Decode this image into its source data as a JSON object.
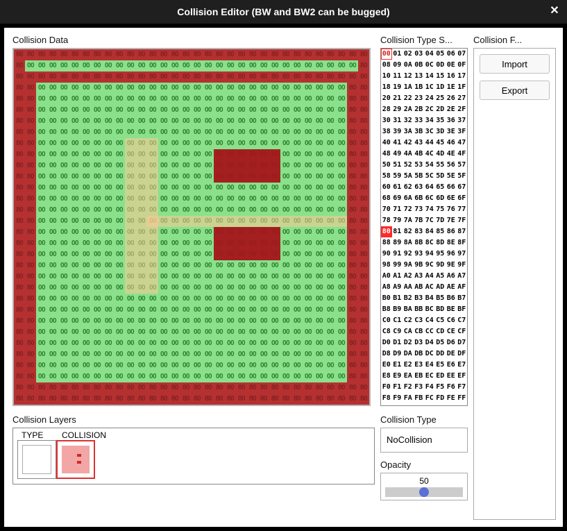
{
  "title": "Collision Editor (BW and BW2 can be bugged)",
  "labels": {
    "collision_data": "Collision Data",
    "type_selector": "Collision Type S...",
    "collision_file": "Collision F...",
    "import": "Import",
    "export": "Export",
    "collision_layers": "Collision Layers",
    "layer_type": "TYPE",
    "layer_collision": "COLLISION",
    "collision_type": "Collision Type",
    "collision_type_value": "NoCollision",
    "opacity": "Opacity",
    "opacity_value": "50"
  },
  "grid": {
    "size": 32,
    "cells": "built-in-script"
  },
  "type_rows": [
    "00 01 02 03 04 05 06 07",
    "08 09 0A 0B 0C 0D 0E 0F",
    "10 11 12 13 14 15 16 17",
    "18 19 1A 1B 1C 1D 1E 1F",
    "20 21 22 23 24 25 26 27",
    "28 29 2A 2B 2C 2D 2E 2F",
    "30 31 32 33 34 35 36 37",
    "38 39 3A 3B 3C 3D 3E 3F",
    "40 41 42 43 44 45 46 47",
    "48 49 4A 4B 4C 4D 4E 4F",
    "50 51 52 53 54 55 56 57",
    "58 59 5A 5B 5C 5D 5E 5F",
    "60 61 62 63 64 65 66 67",
    "68 69 6A 6B 6C 6D 6E 6F",
    "70 71 72 73 74 75 76 77",
    "78 79 7A 7B 7C 7D 7E 7F",
    "80 81 82 83 84 85 86 87",
    "88 89 8A 8B 8C 8D 8E 8F",
    "90 91 92 93 94 95 96 97",
    "98 99 9A 9B 9C 9D 9E 9F",
    "A0 A1 A2 A3 A4 A5 A6 A7",
    "A8 A9 AA AB AC AD AE AF",
    "B0 B1 B2 B3 B4 B5 B6 B7",
    "B8 B9 BA BB BC BD BE BF",
    "C0 C1 C2 C3 C4 C5 C6 C7",
    "C8 C9 CA CB CC CD CE CF",
    "D0 D1 D2 D3 D4 D5 D6 D7",
    "D8 D9 DA DB DC DD DE DF",
    "E0 E1 E2 E3 E4 E5 E6 E7",
    "E8 E9 EA EB EC ED EE EF",
    "F0 F1 F2 F3 F4 F5 F6 F7",
    "F8 F9 FA FB FC FD FE FF"
  ],
  "selected_type_hex": "80",
  "outlined_type_hex": "00",
  "collision_map_80_regions": {
    "description": "Cells with value 80 (collision). Coordinates zero-indexed, size 32x32.",
    "border_outer": {
      "rows": [
        0,
        31
      ],
      "cols_full": true
    },
    "border_sides": {
      "cols": [
        0,
        31
      ],
      "rows_full": true
    },
    "inner_ring": {
      "top_row": 2,
      "bottom_row": 30,
      "left_col": 1,
      "right_col": 30,
      "thickness": 1
    },
    "blocks": [
      {
        "row_start": 9,
        "row_end": 11,
        "col_start": 18,
        "col_end": 23
      },
      {
        "row_start": 16,
        "row_end": 18,
        "col_start": 18,
        "col_end": 23
      }
    ]
  },
  "overlay_regions": [
    {
      "name": "column-highlight",
      "row_start": 8,
      "row_end": 21,
      "col_start": 10,
      "col_end": 12,
      "tint": "orange"
    },
    {
      "name": "row-highlight",
      "row_start": 15,
      "row_end": 16,
      "col_start": 12,
      "col_end": 30,
      "tint": "orange-faint"
    }
  ]
}
